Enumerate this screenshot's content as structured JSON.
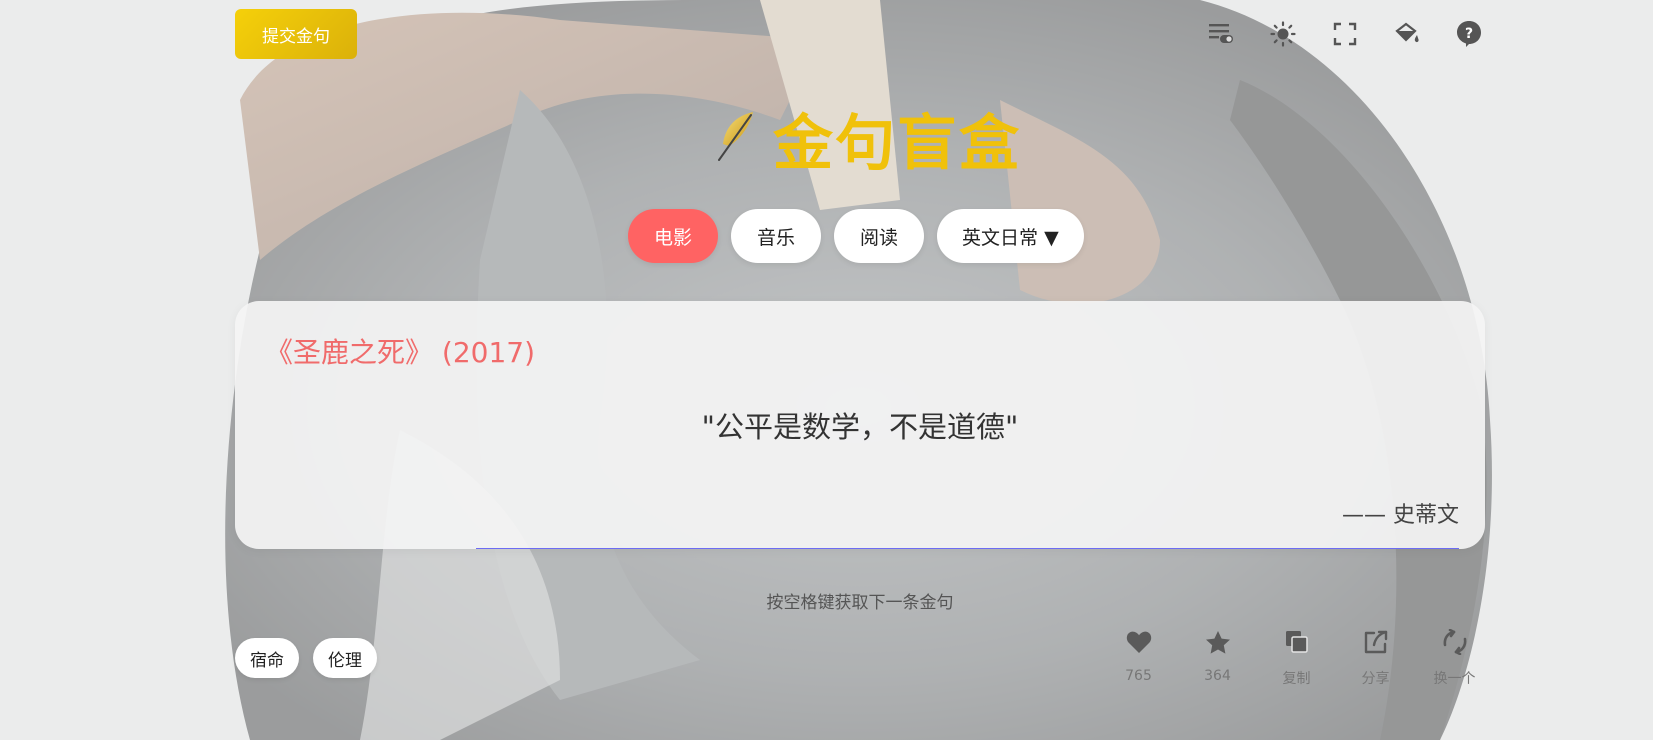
{
  "header": {
    "submit_label": "提交金句",
    "tools": [
      {
        "name": "toggle-settings-icon"
      },
      {
        "name": "sun-icon"
      },
      {
        "name": "fullscreen-icon"
      },
      {
        "name": "paint-bucket-icon"
      },
      {
        "name": "help-icon"
      }
    ]
  },
  "logo": {
    "title": "金句盲盒",
    "icon": "feather-quill-icon"
  },
  "tabs": [
    {
      "label": "电影",
      "active": true
    },
    {
      "label": "音乐",
      "active": false
    },
    {
      "label": "阅读",
      "active": false
    },
    {
      "label": "英文日常 ▼",
      "active": false
    }
  ],
  "card": {
    "source": "《圣鹿之死》 (2017)",
    "quote": "\"公平是数学，不是道德\"",
    "author": "—— 史蒂文"
  },
  "hint": "按空格键获取下一条金句",
  "tags": [
    "宿命",
    "伦理"
  ],
  "actions": {
    "like": {
      "label": "765",
      "icon": "heart-icon"
    },
    "favorite": {
      "label": "364",
      "icon": "star-icon"
    },
    "copy": {
      "label": "复制",
      "icon": "copy-icon"
    },
    "share": {
      "label": "分享",
      "icon": "share-icon"
    },
    "next": {
      "label": "换一个",
      "icon": "refresh-icon"
    }
  },
  "colors": {
    "accent": "#ff6363",
    "brand_yellow": "#f0c10a",
    "source_red": "#f06b6b",
    "icon_gray": "#555555"
  }
}
